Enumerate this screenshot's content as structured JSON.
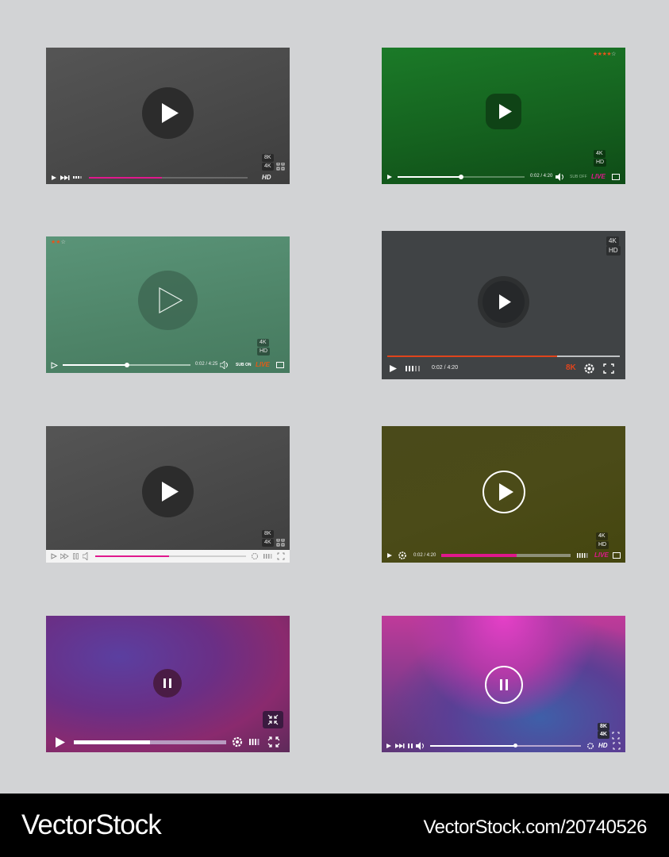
{
  "players": [
    {
      "name": "player-1",
      "badges": [
        "8K",
        "4K"
      ],
      "hd_label": "HD",
      "progress": 0.46,
      "accent": "#e0188d"
    },
    {
      "name": "player-2",
      "rating": 4,
      "rating_max": 5,
      "badges": [
        "4K",
        "HD"
      ],
      "time": "0:02 / 4:20",
      "sub_label": "SUB OFF",
      "live_label": "LIVE",
      "progress": 0.5,
      "accent": "#e0188d"
    },
    {
      "name": "player-3",
      "rating": 2,
      "rating_max": 3,
      "badges": [
        "4K",
        "HD"
      ],
      "time": "0:02 / 4:25",
      "sub_label": "SUB ON",
      "live_label": "LIVE",
      "progress": 0.5,
      "accent": "#e65a14"
    },
    {
      "name": "player-4",
      "badges": [
        "4K",
        "HD"
      ],
      "time": "0:02 / 4:20",
      "quality_label": "8K",
      "progress": 0.73,
      "accent": "#e0441c"
    },
    {
      "name": "player-5",
      "badges": [
        "8K",
        "4K"
      ],
      "progress": 0.49,
      "accent": "#e0188d"
    },
    {
      "name": "player-6",
      "badges": [
        "4K",
        "HD"
      ],
      "time": "0:02 / 4:20",
      "live_label": "LIVE",
      "progress": 0.58,
      "accent": "#e0188d"
    },
    {
      "name": "player-7",
      "progress": 0.5,
      "state": "paused"
    },
    {
      "name": "player-8",
      "badges": [
        "8K",
        "4K"
      ],
      "hd_label": "HD",
      "progress": 0.57,
      "state": "paused"
    }
  ],
  "footer": {
    "logo": "VectorStock",
    "image_id": "VectorStock.com/20740526"
  }
}
